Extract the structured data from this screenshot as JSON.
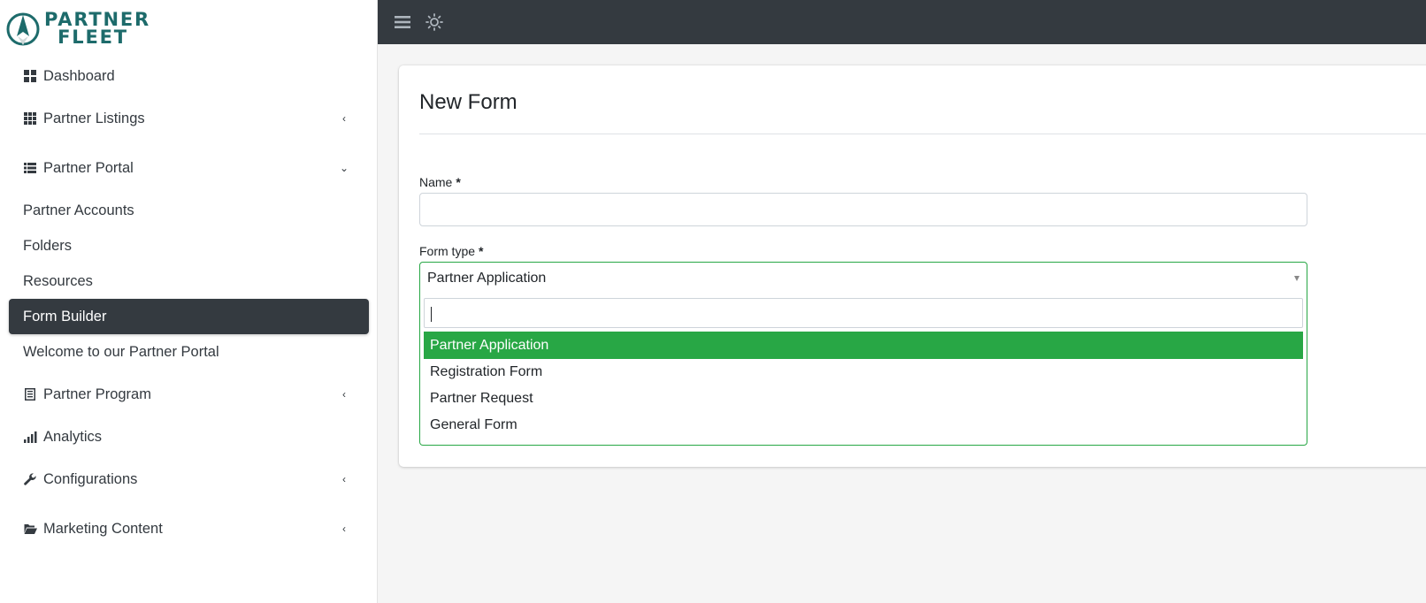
{
  "brand": {
    "line1": "PARTNER",
    "line2": "FLEET",
    "color": "#1d6b6b"
  },
  "sidebar": {
    "items": [
      {
        "label": "Dashboard",
        "icon": "dashboard-icon"
      },
      {
        "label": "Partner Listings",
        "icon": "grid-icon",
        "caret": "‹"
      },
      {
        "label": "Partner Portal",
        "icon": "list-icon",
        "caret": "⌄"
      },
      {
        "label": "Partner Program",
        "icon": "program-icon",
        "caret": "‹"
      },
      {
        "label": "Analytics",
        "icon": "bar-chart-icon"
      },
      {
        "label": "Configurations",
        "icon": "wrench-icon",
        "caret": "‹"
      },
      {
        "label": "Marketing Content",
        "icon": "folder-open-icon",
        "caret": "‹"
      }
    ],
    "portal_subitems": [
      {
        "label": "Partner Accounts"
      },
      {
        "label": "Folders"
      },
      {
        "label": "Resources"
      },
      {
        "label": "Form Builder",
        "active": true
      },
      {
        "label": "Welcome to our Partner Portal"
      }
    ]
  },
  "topbar": {
    "menu_icon": "hamburger-icon",
    "theme_icon": "sun-icon"
  },
  "form": {
    "title": "New Form",
    "name_label": "Name",
    "name_value": "",
    "required_mark": "*",
    "type_label": "Form type",
    "type_value": "Partner Application",
    "search_value": "",
    "options": [
      "Partner Application",
      "Registration Form",
      "Partner Request",
      "General Form"
    ],
    "selected_option": "Partner Application"
  },
  "colors": {
    "accent": "#28a745",
    "dark": "#343a40",
    "background": "#f5f5f5"
  }
}
